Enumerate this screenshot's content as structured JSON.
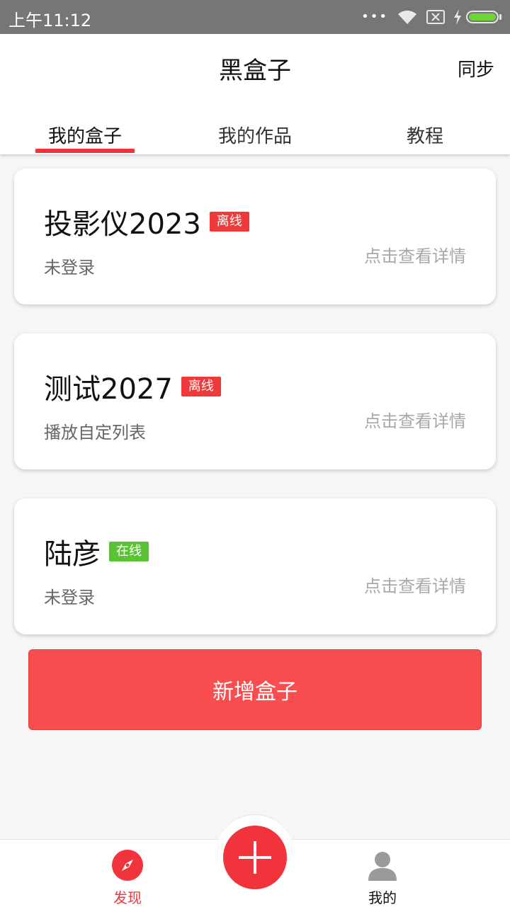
{
  "status_bar": {
    "time": "上午11:12",
    "dots": "•••"
  },
  "header": {
    "title": "黑盒子",
    "sync_label": "同步"
  },
  "tabs": [
    {
      "label": "我的盒子",
      "active": true
    },
    {
      "label": "我的作品",
      "active": false
    },
    {
      "label": "教程",
      "active": false
    }
  ],
  "boxes": [
    {
      "name": "投影仪2023",
      "status": "离线",
      "subtitle": "未登录",
      "detail_link": "点击查看详情"
    },
    {
      "name": "测试2027",
      "status": "离线",
      "subtitle": "播放自定列表",
      "detail_link": "点击查看详情"
    },
    {
      "name": "陆彦",
      "status": "在线",
      "subtitle": "未登录",
      "detail_link": "点击查看详情"
    }
  ],
  "add_button_label": "新增盒子",
  "bottom_nav": [
    {
      "label": "发现",
      "icon": "compass-icon",
      "active": true
    },
    {
      "label": "",
      "icon": "plus-icon",
      "active": false
    },
    {
      "label": "我的",
      "icon": "user-icon",
      "active": false
    }
  ],
  "colors": {
    "accent": "#f1333b",
    "add_button": "#f84e50",
    "online": "#5bc236",
    "offline": "#ee3a3a"
  }
}
